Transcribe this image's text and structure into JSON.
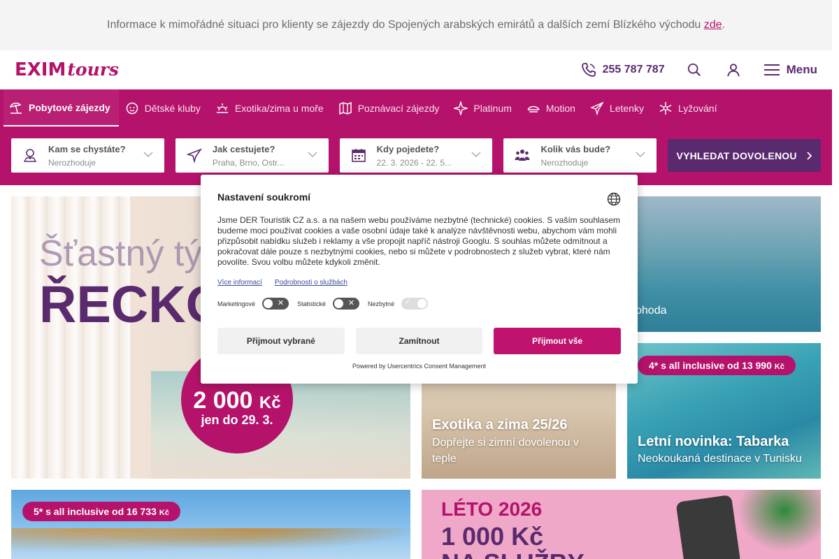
{
  "infobar": {
    "text": "Informace k mimořádné situaci pro klienty se zájezdy do Spojených arabských emirátů a dalších zemí Blízkého východu ",
    "link": "zde",
    "tail": "."
  },
  "header": {
    "logo_main": "EXIM",
    "logo_sub": "tours",
    "phone": "255 787 787",
    "menu_label": "Menu"
  },
  "nav": {
    "categories": [
      {
        "label": "Pobytové zájezdy",
        "icon": "beach-umbrella-icon"
      },
      {
        "label": "Dětské kluby",
        "icon": "kids-club-icon"
      },
      {
        "label": "Exotika/zima u moře",
        "icon": "sun-icon"
      },
      {
        "label": "Poznávací zájezdy",
        "icon": "map-icon"
      },
      {
        "label": "Platinum",
        "icon": "sparkle-icon"
      },
      {
        "label": "Motion",
        "icon": "motion-icon"
      },
      {
        "label": "Letenky",
        "icon": "plane-icon"
      },
      {
        "label": "Lyžování",
        "icon": "snowflake-icon"
      }
    ]
  },
  "search": {
    "destination": {
      "title": "Kam se chystáte?",
      "value": "Nerozhoduje"
    },
    "departure": {
      "title": "Jak cestujete?",
      "value": "Praha, Brno, Ostr..."
    },
    "dates": {
      "title": "Kdy pojedete?",
      "value": "22. 3. 2026 - 22. 5..."
    },
    "people": {
      "title": "Kolik vás bude?",
      "value": "Nerozhoduje"
    },
    "button": "VYHLEDAT DOVOLENOU"
  },
  "tiles": {
    "greece": {
      "line1": "Šťastný týd",
      "line2": "ŘECKO",
      "price": "2 000",
      "currency": "Kč",
      "until": "jen do 29. 3."
    },
    "top_right": {
      "text": "ohoda"
    },
    "exotika": {
      "title": "Exotika a zima 25/26",
      "subtitle": "Dopřejte si zimní dovolenou v teple"
    },
    "tabarka": {
      "pill": "4* s all inclusive od 13 990",
      "pill_currency": "Kč",
      "title": "Letní novinka: Tabarka",
      "subtitle": "Neokoukaná destinace v Tunisku"
    },
    "bottom_left": {
      "pill": "5* s all inclusive od 16 733",
      "pill_currency": "Kč"
    },
    "bottom_right": {
      "line1": "LÉTO 2026",
      "line2": "1 000 Kč",
      "line3": "NA SLUŽBY"
    }
  },
  "cookie": {
    "title": "Nastavení soukromí",
    "text": "Jsme DER Touristik CZ a.s. a na našem webu používáme nezbytné (technické) cookies. S vaším souhlasem budeme moci používat cookies a vaše osobní údaje také k analýze návštěvnosti webu, abychom vám mohli přizpůsobit nabídku služeb i reklamy a vše propojit napříč nástroji Googlu. S souhlas můžete odmítnout a pokračovat dále pouze s nezbytnými cookies, nebo si můžete v podrobnostech z služeb vybrat, které nám povolíte. Svou volbu můžete kdykoli změnit.",
    "link_more": "Více informací",
    "link_details": "Podrobnosti o službách",
    "toggle_marketing": "Marketingové",
    "toggle_stats": "Statistické",
    "toggle_necessary": "Nezbytné",
    "btn_accept_selected": "Přijmout vybrané",
    "btn_reject": "Zamítnout",
    "btn_accept_all": "Přijmout vše",
    "powered": "Powered by Usercentrics Consent Management"
  },
  "colors": {
    "brand_pink": "#b5136b",
    "brand_purple": "#5a2a6e",
    "accept_button": "#c0136e"
  }
}
